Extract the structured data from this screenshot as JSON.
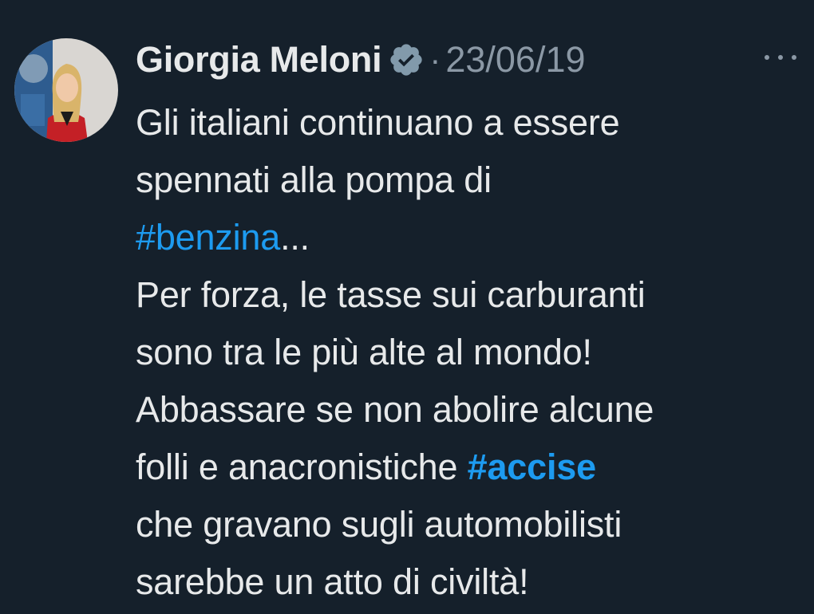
{
  "author": {
    "name": "Giorgia Meloni",
    "verified_icon": "verified-badge-icon",
    "separator": "·",
    "date": "23/06/19"
  },
  "menu": {
    "icon": "more-options-icon"
  },
  "tweet": {
    "line1": "Gli italiani continuano a essere",
    "line2": "spennati alla pompa di",
    "hashtag_benzina": "#benzina",
    "ellipsis": "...",
    "line4": "Per forza, le tasse sui carburanti",
    "line5": "sono tra le più alte al mondo!",
    "line6": "Abbassare se non abolire alcune",
    "line7_pre": "folli e anacronistiche ",
    "hashtag_accise": "#accise",
    "line8": "che gravano sugli automobilisti",
    "line9": "sarebbe un atto di civiltà!"
  },
  "colors": {
    "background": "#15202b",
    "text": "#e7e9ea",
    "muted": "#8b98a5",
    "link": "#1d9bf0"
  }
}
